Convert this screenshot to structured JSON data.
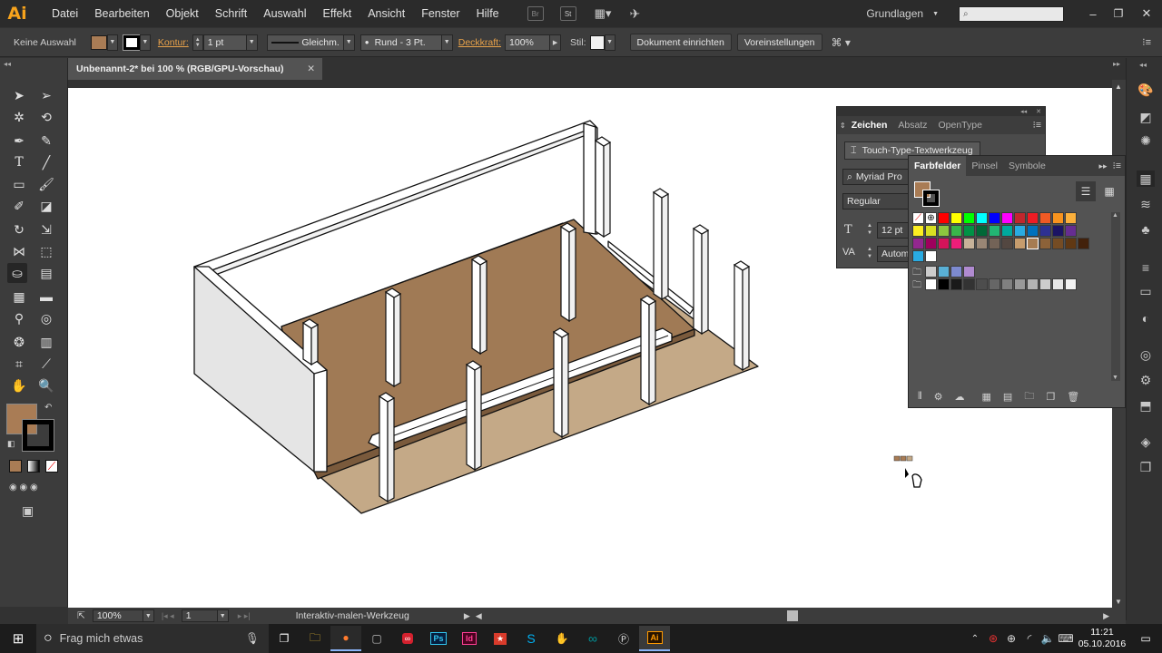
{
  "app": {
    "logo": "Ai"
  },
  "menu": [
    "Datei",
    "Bearbeiten",
    "Objekt",
    "Schrift",
    "Auswahl",
    "Effekt",
    "Ansicht",
    "Fenster",
    "Hilfe"
  ],
  "bridge_labels": [
    "Br",
    "St"
  ],
  "workspace": {
    "label": "Grundlagen"
  },
  "control": {
    "selection": "Keine Auswahl",
    "kontur_label": "Kontur:",
    "stroke_weight": "1 pt",
    "stroke_profile": "Gleichm.",
    "brush": "Rund - 3 Pt.",
    "opacity_label": "Deckkraft:",
    "opacity": "100%",
    "style_label": "Stil:",
    "doc_setup": "Dokument einrichten",
    "prefs": "Voreinstellungen"
  },
  "document": {
    "tab": "Unbenannt-2* bei 100 % (RGB/GPU-Vorschau)"
  },
  "colors": {
    "fill": "#a97c55",
    "floor": "#a07a55",
    "ground": "#c4a987",
    "accent": "#f7a31c"
  },
  "zeichen_panel": {
    "tabs": [
      "Zeichen",
      "Absatz",
      "OpenType"
    ],
    "touch_type": "Touch-Type-Textwerkzeug",
    "font": "Myriad Pro",
    "style": "Regular",
    "size": "12 pt",
    "kerning": "Autom"
  },
  "farbfelder_panel": {
    "tabs": [
      "Farbfelder",
      "Pinsel",
      "Symbole"
    ],
    "swatch_rows": [
      [
        "#ffffff",
        "#000000",
        "#ff0000",
        "#ffff00",
        "#00ff00",
        "#00ffff",
        "#0000ff",
        "#ff00ff",
        "#c1272d",
        "#ed1c24",
        "#f15a24",
        "#f7931e",
        "#fbb03b"
      ],
      [
        "#fcee21",
        "#d9e021",
        "#8cc63f",
        "#39b54a",
        "#009245",
        "#006837",
        "#22b573",
        "#00a99d",
        "#29abe2",
        "#0071bc",
        "#2e3192",
        "#1b1464",
        "#662d91"
      ],
      [
        "#93278f",
        "#9e005d",
        "#d4145a",
        "#ed1e79",
        "#c7b299",
        "#998675",
        "#736357",
        "#534741",
        "#c69c6d",
        "#a67c52",
        "#8c6239",
        "#754c24",
        "#603813",
        "#42210b"
      ],
      [
        "#29abe2",
        "#ffffff"
      ],
      [
        "#cccccc",
        "#59b0d6",
        "#7d8ad0",
        "#b08ad0"
      ],
      [
        "#ffffff",
        "#000000",
        "#1a1a1a",
        "#333333",
        "#4d4d4d",
        "#666666",
        "#808080",
        "#999999",
        "#b3b3b3",
        "#cccccc",
        "#e6e6e6",
        "#f2f2f2"
      ]
    ]
  },
  "statusbar": {
    "zoom": "100%",
    "page": "1",
    "tool": "Interaktiv-malen-Werkzeug"
  },
  "taskbar": {
    "search": "Frag mich etwas",
    "time": "11:21",
    "date": "05.10.2016"
  }
}
